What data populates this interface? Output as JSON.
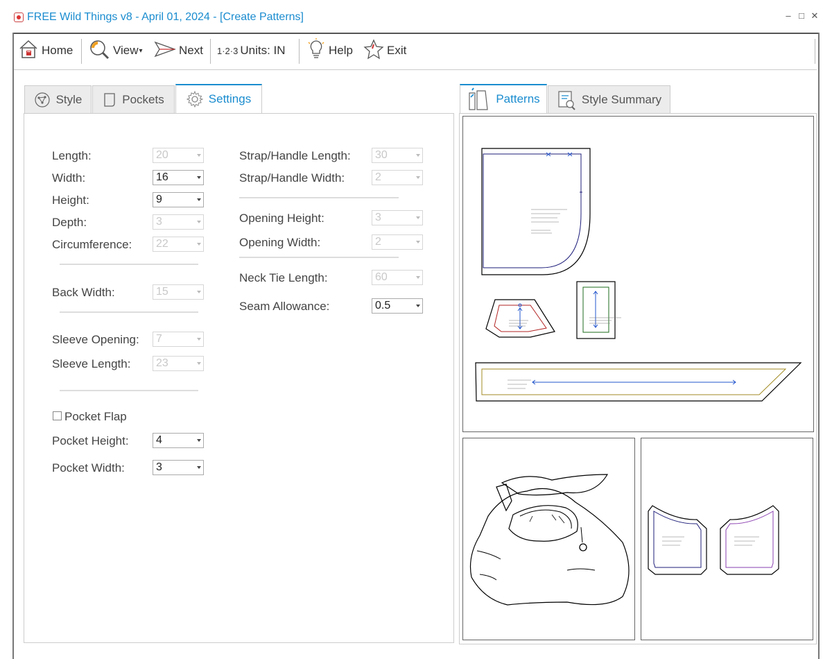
{
  "window": {
    "title": "FREE Wild Things v8 - April 01, 2024 - [Create Patterns]",
    "minimize": "–",
    "maximize": "□",
    "close": "✕"
  },
  "toolbar": {
    "home": "Home",
    "view": "View",
    "view_caret": "▾",
    "next": "Next",
    "units_prefix": "1·2·3",
    "units": "Units: IN",
    "help": "Help",
    "exit": "Exit"
  },
  "left_tabs": [
    {
      "label": "Style",
      "active": false
    },
    {
      "label": "Pockets",
      "active": false
    },
    {
      "label": "Settings",
      "active": true
    }
  ],
  "right_tabs": [
    {
      "label": "Patterns",
      "active": true
    },
    {
      "label": "Style Summary",
      "active": false
    }
  ],
  "settings_left": {
    "length": {
      "label": "Length:",
      "value": "20",
      "enabled": false
    },
    "width": {
      "label": "Width:",
      "value": "16",
      "enabled": true
    },
    "height": {
      "label": "Height:",
      "value": "9",
      "enabled": true
    },
    "depth": {
      "label": "Depth:",
      "value": "3",
      "enabled": false
    },
    "circumference": {
      "label": "Circumference:",
      "value": "22",
      "enabled": false
    },
    "back_width": {
      "label": "Back Width:",
      "value": "15",
      "enabled": false
    },
    "sleeve_opening": {
      "label": "Sleeve Opening:",
      "value": "7",
      "enabled": false
    },
    "sleeve_length": {
      "label": "Sleeve Length:",
      "value": "23",
      "enabled": false
    },
    "pocket_flap": {
      "label": "Pocket Flap",
      "checked": false
    },
    "pocket_height": {
      "label": "Pocket Height:",
      "value": "4",
      "enabled": true
    },
    "pocket_width": {
      "label": "Pocket Width:",
      "value": "3",
      "enabled": true
    }
  },
  "settings_right": {
    "strap_length": {
      "label": "Strap/Handle Length:",
      "value": "30",
      "enabled": false
    },
    "strap_width": {
      "label": "Strap/Handle Width:",
      "value": "2",
      "enabled": false
    },
    "opening_height": {
      "label": "Opening Height:",
      "value": "3",
      "enabled": false
    },
    "opening_width": {
      "label": "Opening Width:",
      "value": "2",
      "enabled": false
    },
    "neck_tie_length": {
      "label": "Neck Tie Length:",
      "value": "60",
      "enabled": false
    },
    "seam_allowance": {
      "label": "Seam Allowance:",
      "value": "0.5",
      "enabled": true
    }
  },
  "colors": {
    "accent": "#1a8ccf",
    "pattern_navy": "#1c1c7a",
    "pattern_red": "#b22222",
    "pattern_green": "#1e6b1e",
    "pattern_olive": "#a08a20",
    "pattern_purple": "#8a3fb0",
    "arrow_blue": "#2255cc"
  }
}
